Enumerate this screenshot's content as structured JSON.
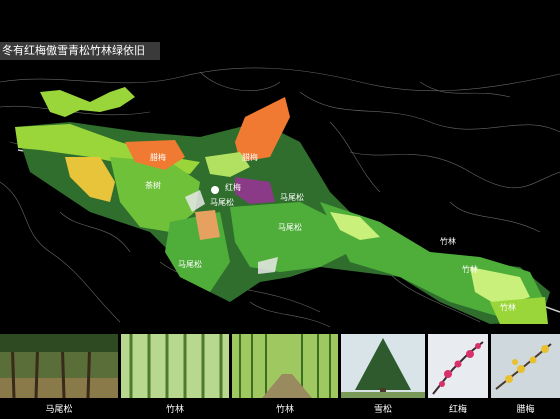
{
  "header": {
    "title": "冬有红梅傲雪青松竹林绿依旧"
  },
  "map": {
    "zones": {
      "z1": "茶树",
      "z2": "腊梅",
      "z3": "腊梅",
      "z4": "红梅",
      "z5": "马尾松",
      "z6": "马尾松",
      "z7": "马尾松",
      "z8": "马尾松",
      "z9": "竹林",
      "z10": "竹林",
      "z11": "竹林"
    }
  },
  "photos": [
    {
      "caption": "马尾松",
      "icon": "pine-forest"
    },
    {
      "caption": "竹林",
      "icon": "bamboo"
    },
    {
      "caption": "竹林",
      "icon": "bamboo-path"
    },
    {
      "caption": "雪松",
      "icon": "cedar-tree"
    },
    {
      "caption": "红梅",
      "icon": "red-plum"
    },
    {
      "caption": "腊梅",
      "icon": "wintersweet"
    }
  ],
  "colors": {
    "background": "#000000",
    "green_light": "#9ad63a",
    "green_mid": "#4fae3a",
    "green_dark": "#2f6e2c",
    "orange": "#f07a32",
    "yellow": "#e8c43a",
    "purple": "#8a3a86",
    "lime": "#c8f07a"
  }
}
